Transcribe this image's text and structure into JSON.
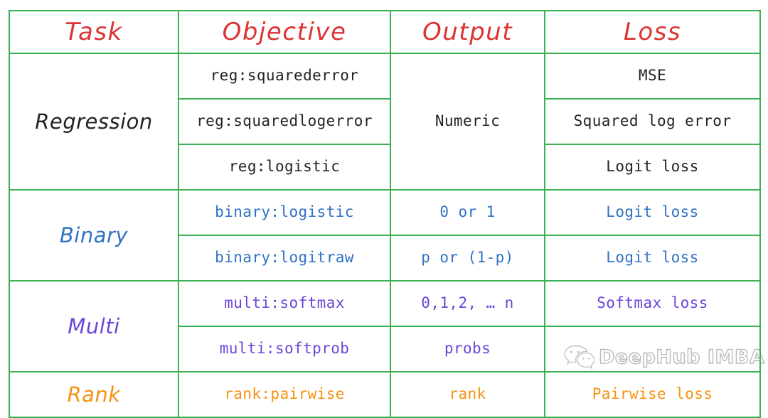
{
  "table": {
    "headers": [
      {
        "label": "Task",
        "color": "#dd3333"
      },
      {
        "label": "Objective",
        "color": "#dd3333"
      },
      {
        "label": "Output",
        "color": "#dd3333"
      },
      {
        "label": "Loss",
        "color": "#dd3333"
      }
    ],
    "groups": [
      {
        "task": "Regression",
        "color": "#232323",
        "output": "Numeric",
        "rows": [
          {
            "objective": "reg:squarederror",
            "loss": "MSE"
          },
          {
            "objective": "reg:squaredlogerror",
            "loss": "Squared log error"
          },
          {
            "objective": "reg:logistic",
            "loss": "Logit loss"
          }
        ]
      },
      {
        "task": "Binary",
        "color": "#2f72c4",
        "rows": [
          {
            "objective": "binary:logistic",
            "output": "0 or 1",
            "loss": "Logit loss"
          },
          {
            "objective": "binary:logitraw",
            "output": "p or (1-p)",
            "loss": "Logit loss"
          }
        ]
      },
      {
        "task": "Multi",
        "color": "#6c45d9",
        "rows": [
          {
            "objective": "multi:softmax",
            "output": "0,1,2, … n",
            "loss": "Softmax loss"
          },
          {
            "objective": "multi:softprob",
            "output": "probs",
            "loss": ""
          }
        ]
      },
      {
        "task": "Rank",
        "color": "#f59211",
        "rows": [
          {
            "objective": "rank:pairwise",
            "output": "rank",
            "loss": "Pairwise loss"
          }
        ]
      }
    ]
  },
  "watermark": {
    "icon": "wechat-chat-bubbles-icon",
    "text": "DeepHub IMBA"
  },
  "colors": {
    "grid": "#3cb054",
    "header_text": "#dd3333",
    "regression": "#232323",
    "binary": "#2f72c4",
    "multi": "#6c45d9",
    "rank": "#f59211",
    "background": "#ffffff"
  }
}
